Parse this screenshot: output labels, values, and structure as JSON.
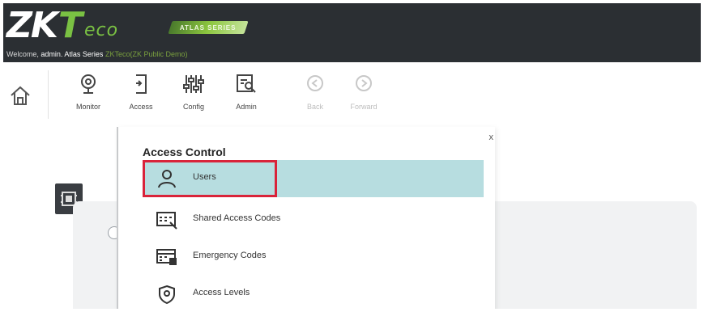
{
  "header": {
    "logo_text": "ZKTeco",
    "series_badge": "ATLAS SERIES",
    "welcome_prefix": "Welcome,",
    "welcome_user": "admin.",
    "welcome_series": "Atlas Series",
    "welcome_site": "ZKTeco(ZK Public Demo)"
  },
  "toolbar": {
    "home_icon": "house-icon",
    "items": [
      {
        "label": "Monitor",
        "icon": "webcam-icon"
      },
      {
        "label": "Access",
        "icon": "door-icon"
      },
      {
        "label": "Config",
        "icon": "sliders-icon"
      },
      {
        "label": "Admin",
        "icon": "admin-search-icon"
      },
      {
        "label": "Back",
        "icon": "back-circle-icon",
        "disabled": true
      },
      {
        "label": "Forward",
        "icon": "forward-circle-icon",
        "disabled": true
      }
    ]
  },
  "panel": {
    "title": "Access Control",
    "close_glyph": "x",
    "items": [
      {
        "label": "Users",
        "icon": "person-icon",
        "active": true
      },
      {
        "label": "Shared Access Codes",
        "icon": "keypad-icon"
      },
      {
        "label": "Emergency Codes",
        "icon": "emergency-keypad-icon"
      },
      {
        "label": "Access Levels",
        "icon": "shield-icon"
      }
    ]
  },
  "colors": {
    "header_bg": "#2b2f33",
    "brand_green": "#7ac143",
    "active_row": "#b7dde0",
    "highlight_red": "#d9233a"
  }
}
